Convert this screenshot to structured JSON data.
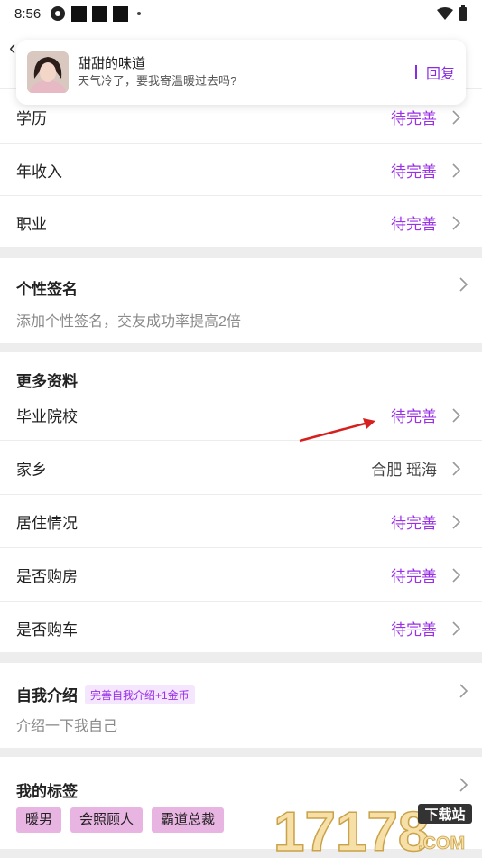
{
  "status_bar": {
    "time": "8:56"
  },
  "notification": {
    "sender": "甜甜的味道",
    "message": "天气冷了，要我寄温暖过去吗?",
    "reply_label": "回复"
  },
  "basic_rows": [
    {
      "label": "学历",
      "value": "待完善"
    },
    {
      "label": "年收入",
      "value": "待完善"
    },
    {
      "label": "职业",
      "value": "待完善"
    }
  ],
  "signature": {
    "title": "个性签名",
    "placeholder": "添加个性签名，交友成功率提高2倍"
  },
  "more_info": {
    "title": "更多资料",
    "rows": [
      {
        "label": "毕业院校",
        "value": "待完善"
      },
      {
        "label": "家乡",
        "value": "合肥 瑶海"
      },
      {
        "label": "居住情况",
        "value": "待完善"
      },
      {
        "label": "是否购房",
        "value": "待完善"
      },
      {
        "label": "是否购车",
        "value": "待完善"
      }
    ]
  },
  "intro": {
    "title": "自我介绍",
    "badge": "完善自我介绍+1金币",
    "placeholder": "介绍一下我自己"
  },
  "tags_section": {
    "title": "我的标签",
    "tags": [
      "暖男",
      "会照顾人",
      "霸道总裁"
    ]
  },
  "watermark": {
    "number": "17178",
    "site": "下载站",
    "domain": ".COM"
  },
  "colors": {
    "accent": "#9b30e6",
    "tag_bg": "#e8b4e1"
  }
}
